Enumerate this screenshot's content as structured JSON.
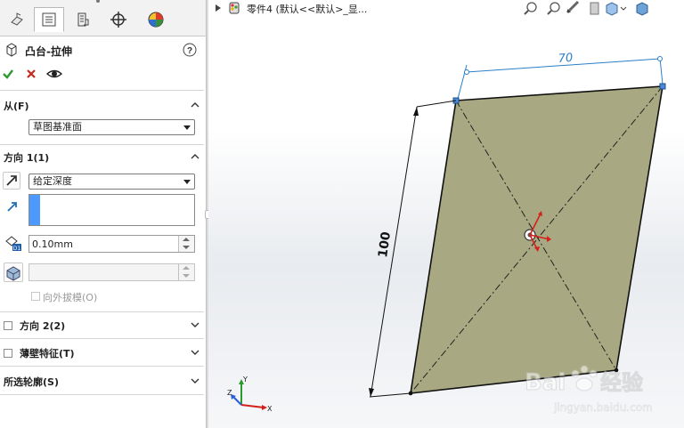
{
  "tabs": [
    {
      "name": "feature-manager-tab",
      "icon": "feature-tree-icon"
    },
    {
      "name": "property-manager-tab",
      "icon": "property-manager-icon"
    },
    {
      "name": "configuration-manager-tab",
      "icon": "configuration-icon"
    },
    {
      "name": "dimxpert-tab",
      "icon": "crosshair-icon"
    },
    {
      "name": "display-manager-tab",
      "icon": "appearance-pie-icon"
    }
  ],
  "feature": {
    "title": "凸台-拉伸",
    "help_icon": "help-icon"
  },
  "actions": {
    "ok": "check-icon",
    "cancel": "cross-icon",
    "preview": "eye-icon"
  },
  "from": {
    "title": "从(F)",
    "value": "草图基准面"
  },
  "direction1": {
    "title": "方向 1(1)",
    "end_condition": "给定深度",
    "depth_value": "0.10mm",
    "draft_outward_label": "向外拔模(O)"
  },
  "direction2": {
    "title": "方向 2(2)",
    "checked": false
  },
  "thin_feature": {
    "title": "薄壁特征(T)",
    "checked": false
  },
  "selected_contours": {
    "title": "所选轮廓(S)"
  },
  "breadcrumb": {
    "text": "零件4  (默认<<默认>_显..."
  },
  "sketch": {
    "dim_horizontal": "70",
    "dim_vertical": "100",
    "face_color": "#a8a882",
    "dim_color": "#2a7fc9"
  },
  "triad": {
    "x": "X",
    "y": "Y",
    "z": "Z"
  },
  "watermark": {
    "brand": "Bai",
    "brand2": "经验",
    "url": "jingyan.baidu.com"
  },
  "colors": {
    "ok": "#2d9b2d",
    "cancel": "#c8281e",
    "accent": "#3c8cff"
  }
}
